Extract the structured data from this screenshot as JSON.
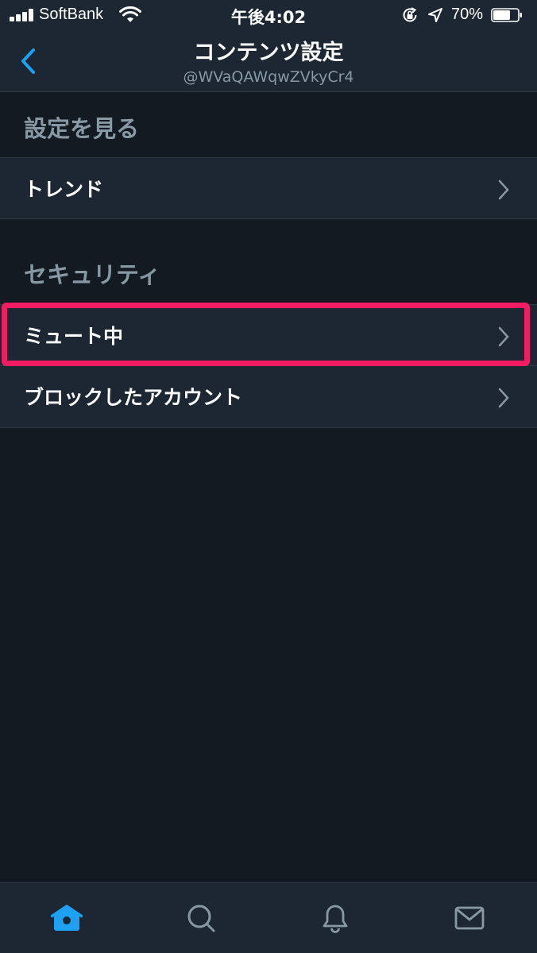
{
  "status_bar": {
    "carrier": "SoftBank",
    "time": "午後4:02",
    "battery_percent": "70%",
    "battery_level": 0.7,
    "signal_icon": "cellular-signal-icon",
    "wifi_icon": "wifi-icon",
    "rotation_lock_icon": "rotation-lock-icon",
    "location_icon": "location-arrow-icon"
  },
  "nav": {
    "title": "コンテンツ設定",
    "subtitle": "@WVaQAWqwZVkyCr4",
    "back_icon": "chevron-left-icon"
  },
  "sections": [
    {
      "header": "設定を見る",
      "items": [
        {
          "label": "トレンド",
          "icon": "chevron-right-icon"
        }
      ]
    },
    {
      "header": "セキュリティ",
      "items": [
        {
          "label": "ミュート中",
          "icon": "chevron-right-icon",
          "highlighted": true
        },
        {
          "label": "ブロックしたアカウント",
          "icon": "chevron-right-icon"
        }
      ]
    }
  ],
  "tab_bar": {
    "tabs": [
      {
        "name": "home",
        "icon": "home-icon",
        "active": true
      },
      {
        "name": "search",
        "icon": "search-icon",
        "active": false
      },
      {
        "name": "notifications",
        "icon": "bell-icon",
        "active": false
      },
      {
        "name": "messages",
        "icon": "envelope-icon",
        "active": false
      }
    ]
  },
  "colors": {
    "background": "#141a22",
    "surface": "#1c2733",
    "accent": "#1da1f2",
    "muted_text": "#8899a6",
    "highlight": "#f21c62",
    "divider": "#2f3a46"
  }
}
